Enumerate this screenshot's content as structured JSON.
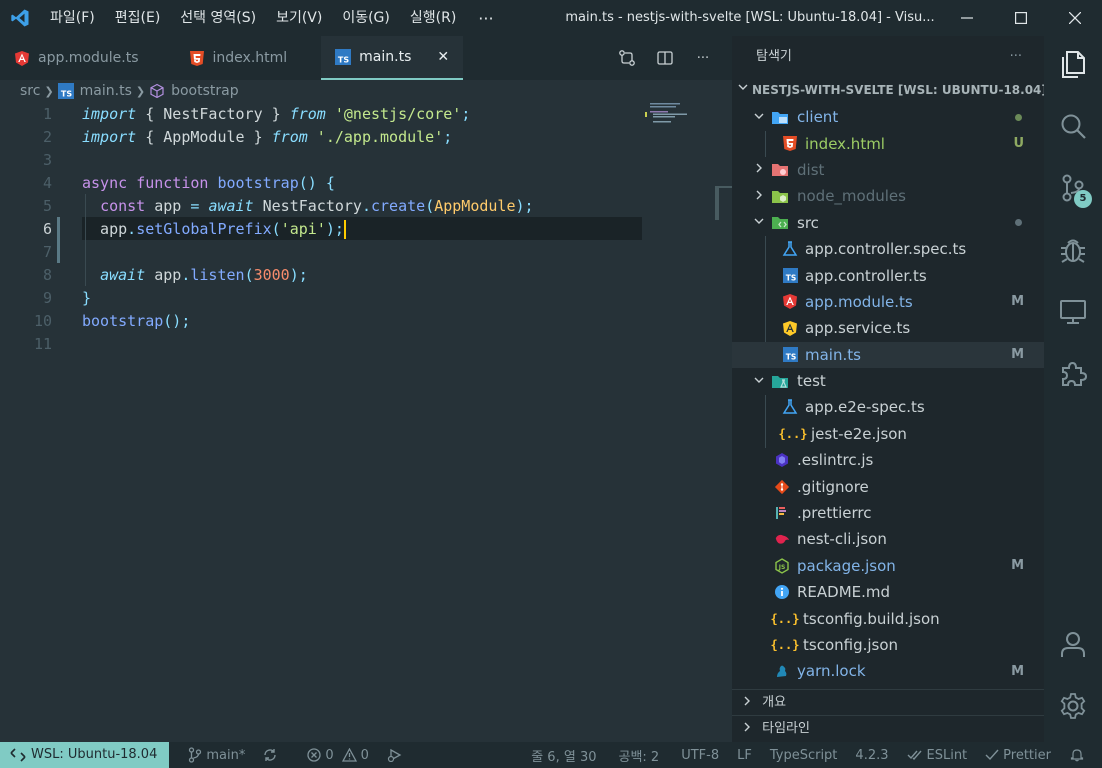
{
  "titlebar": {
    "menu": [
      "파일(F)",
      "편집(E)",
      "선택 영역(S)",
      "보기(V)",
      "이동(G)",
      "실행(R)"
    ],
    "more": "···",
    "title": "main.ts - nestjs-with-svelte [WSL: Ubuntu-18.04] - Visu..."
  },
  "tabs": [
    {
      "label": "app.module.ts",
      "icon": "angular-icon"
    },
    {
      "label": "index.html",
      "icon": "html-icon"
    },
    {
      "label": "main.ts",
      "icon": "typescript-icon",
      "active": true
    }
  ],
  "tab_actions": {
    "more": "···"
  },
  "breadcrumb": {
    "folder": "src",
    "file": "main.ts",
    "symbol": "bootstrap"
  },
  "editor": {
    "current_line": 6,
    "lines": [
      {
        "n": "1",
        "parts": [
          [
            "import",
            "kw-it"
          ],
          [
            " { NestFactory } ",
            ""
          ],
          [
            "from",
            "kw-it"
          ],
          [
            " '",
            "str"
          ],
          [
            "@nestjs/core",
            "str"
          ],
          [
            "'",
            "str"
          ],
          [
            ";",
            "pn"
          ]
        ]
      },
      {
        "n": "2",
        "parts": [
          [
            "import",
            "kw-it"
          ],
          [
            " { AppModule } ",
            ""
          ],
          [
            "from",
            "kw-it"
          ],
          [
            " '",
            "str"
          ],
          [
            "./app.module",
            "str"
          ],
          [
            "'",
            "str"
          ],
          [
            ";",
            "pn"
          ]
        ]
      },
      {
        "n": "3",
        "parts": []
      },
      {
        "n": "4",
        "parts": [
          [
            "async",
            "kw"
          ],
          [
            " ",
            ""
          ],
          [
            "function",
            "kw"
          ],
          [
            " ",
            ""
          ],
          [
            "bootstrap",
            "fn"
          ],
          [
            "() {",
            "pn"
          ]
        ]
      },
      {
        "n": "5",
        "parts": [
          [
            "  ",
            ""
          ],
          [
            "const",
            "kw"
          ],
          [
            " app ",
            ""
          ],
          [
            "=",
            "pn"
          ],
          [
            " ",
            ""
          ],
          [
            "await",
            "kw-it"
          ],
          [
            " NestFactory",
            ""
          ],
          [
            ".",
            "pn"
          ],
          [
            "create",
            "fn"
          ],
          [
            "(",
            "pn"
          ],
          [
            "AppModule",
            "cls"
          ],
          [
            ");",
            "pn"
          ]
        ]
      },
      {
        "n": "6",
        "parts": [
          [
            "  app",
            ""
          ],
          [
            ".",
            "pn"
          ],
          [
            "setGlobalPrefix",
            "fn"
          ],
          [
            "(",
            "pn"
          ],
          [
            "'",
            "str"
          ],
          [
            "api",
            "str"
          ],
          [
            "'",
            "str"
          ],
          [
            ");",
            "pn"
          ]
        ]
      },
      {
        "n": "7",
        "parts": []
      },
      {
        "n": "8",
        "parts": [
          [
            "  ",
            ""
          ],
          [
            "await",
            "kw-it"
          ],
          [
            " app",
            ""
          ],
          [
            ".",
            "pn"
          ],
          [
            "listen",
            "fn"
          ],
          [
            "(",
            "pn"
          ],
          [
            "3000",
            "num"
          ],
          [
            ");",
            "pn"
          ]
        ]
      },
      {
        "n": "9",
        "parts": [
          [
            "}",
            "pn"
          ]
        ]
      },
      {
        "n": "10",
        "parts": [
          [
            "bootstrap",
            "fn"
          ],
          [
            "();",
            "pn"
          ]
        ]
      },
      {
        "n": "11",
        "parts": []
      }
    ]
  },
  "explorer": {
    "title": "탐색기",
    "more": "···",
    "project": "NESTJS-WITH-SVELTE [WSL: UBUNTU-18.04]",
    "items": [
      {
        "label": "client",
        "icon": "folder-client-icon",
        "depth": 1,
        "chev": "v",
        "style": "mod",
        "marker": "dot-green"
      },
      {
        "label": "index.html",
        "icon": "html-icon",
        "depth": 2,
        "style": "untracked",
        "badge": "U"
      },
      {
        "label": "dist",
        "icon": "folder-dist-icon",
        "depth": 1,
        "chev": ">",
        "style": "dim"
      },
      {
        "label": "node_modules",
        "icon": "folder-node-icon",
        "depth": 1,
        "chev": ">",
        "style": "dim"
      },
      {
        "label": "src",
        "icon": "folder-src-icon",
        "depth": 1,
        "chev": "v",
        "style": "",
        "marker": "dot"
      },
      {
        "label": "app.controller.spec.ts",
        "icon": "test-flask-icon",
        "depth": 2,
        "style": ""
      },
      {
        "label": "app.controller.ts",
        "icon": "typescript-icon",
        "depth": 2,
        "style": ""
      },
      {
        "label": "app.module.ts",
        "icon": "angular-icon",
        "depth": 2,
        "style": "mod",
        "badge": "M"
      },
      {
        "label": "app.service.ts",
        "icon": "angular-service-icon",
        "depth": 2,
        "style": ""
      },
      {
        "label": "main.ts",
        "icon": "typescript-icon",
        "depth": 2,
        "style": "mod",
        "badge": "M",
        "selected": true
      },
      {
        "label": "test",
        "icon": "folder-test-icon",
        "depth": 1,
        "chev": "v",
        "style": ""
      },
      {
        "label": "app.e2e-spec.ts",
        "icon": "test-flask-icon",
        "depth": 2,
        "style": ""
      },
      {
        "label": "jest-e2e.json",
        "icon": "json-icon",
        "depth": 2,
        "style": ""
      },
      {
        "label": ".eslintrc.js",
        "icon": "eslint-icon",
        "depth": 1,
        "style": ""
      },
      {
        "label": ".gitignore",
        "icon": "git-icon",
        "depth": 1,
        "style": ""
      },
      {
        "label": ".prettierrc",
        "icon": "prettier-icon",
        "depth": 1,
        "style": ""
      },
      {
        "label": "nest-cli.json",
        "icon": "nest-icon",
        "depth": 1,
        "style": ""
      },
      {
        "label": "package.json",
        "icon": "nodejs-icon",
        "depth": 1,
        "style": "mod",
        "badge": "M"
      },
      {
        "label": "README.md",
        "icon": "info-icon",
        "depth": 1,
        "style": ""
      },
      {
        "label": "tsconfig.build.json",
        "icon": "json-icon",
        "depth": 1,
        "style": ""
      },
      {
        "label": "tsconfig.json",
        "icon": "json-icon",
        "depth": 1,
        "style": ""
      },
      {
        "label": "yarn.lock",
        "icon": "yarn-icon",
        "depth": 1,
        "style": "mod",
        "badge": "M"
      }
    ],
    "sections": [
      "개요",
      "타임라인"
    ]
  },
  "activity": {
    "scm_badge": "5"
  },
  "status": {
    "remote": "WSL: Ubuntu-18.04",
    "branch": "main*",
    "errors": "0",
    "warnings": "0",
    "position": "줄 6, 열 30",
    "spaces": "공백: 2",
    "encoding": "UTF-8",
    "eol": "LF",
    "language": "TypeScript",
    "version": "4.2.3",
    "eslint": "ESLint",
    "prettier": "Prettier"
  },
  "colors": {
    "accent": "#80cbc4",
    "background": "#263238",
    "sidebar": "#1e272c",
    "caret": "#ffcc00"
  }
}
